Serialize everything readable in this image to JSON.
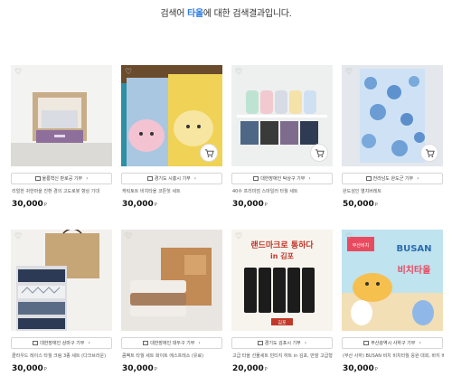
{
  "search_header": {
    "prefix": "검색어",
    "keyword": "타올",
    "suffix": "에 대한 검색결과입니다."
  },
  "colors": {
    "keyword": "#2f7de1",
    "price": "#111111"
  },
  "products": [
    {
      "badge": "울릉혁신 판로공 기부",
      "description": "리얼한 귀한마을 친환 경의 고도로봇 향상 기대",
      "price": "30,000",
      "currency": "P",
      "icon": "heart-icon"
    },
    {
      "badge": "경기도 시흥시 기부",
      "description": "캐릭토트 비치타올 코튼헛 세트",
      "price": "30,000",
      "currency": "P",
      "icon": "heart-icon"
    },
    {
      "badge": "대한장애인 탁상구 기부",
      "description": "40수 프리미엄 스마일러 타월 세트",
      "price": "30,000",
      "currency": "P",
      "icon": "heart-icon"
    },
    {
      "badge": "전라남도 완도군 기부",
      "description": "완도섬인 열치버레트",
      "price": "50,000",
      "currency": "P",
      "icon": "heart-icon"
    },
    {
      "badge": "대한장애인 상마구 기부",
      "description": "클라우드 레이스 타월 크림 3종 세트 (다크브라운)",
      "price": "30,000",
      "currency": "P",
      "icon": "heart-icon"
    },
    {
      "badge": "대한장애인 대두구 기부",
      "description": "콤팩트 타월 세트 화이트 에스프레소 (유료)",
      "price": "30,000",
      "currency": "P",
      "icon": "heart-icon"
    },
    {
      "badge": "경기도 김포시 기부",
      "description": "고급 타올 선물세트 빈티지 하트 in 김포, 반말 고급형 200g 수건",
      "price": "20,000",
      "currency": "P",
      "icon": "heart-icon"
    },
    {
      "badge": "부산광역시 사하구 기부",
      "description": "(부산 사하) BUSAN 비치 비치타월 응원 대회, 바지 비치",
      "price": "30,000",
      "currency": "P",
      "icon": "heart-icon"
    }
  ],
  "banner_text": {
    "kimpo_top": "랜드마크로 통하다",
    "kimpo_sub": "in 김포",
    "kimpo_brand": "김포",
    "busan_top": "BUSAN",
    "busan_title": "비치타올",
    "busan_small": "부산비치"
  }
}
